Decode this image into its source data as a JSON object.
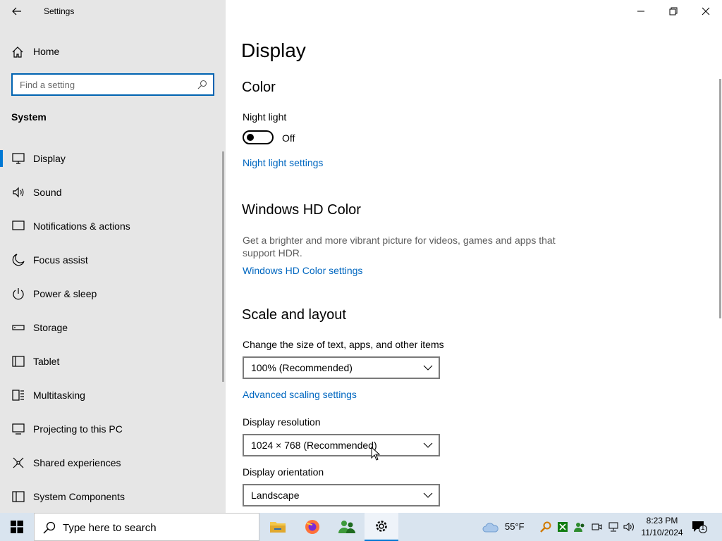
{
  "window": {
    "title": "Settings"
  },
  "sidebar": {
    "home_label": "Home",
    "search_placeholder": "Find a setting",
    "section_label": "System",
    "items": [
      {
        "label": "Display",
        "icon": "monitor-icon",
        "active": true
      },
      {
        "label": "Sound",
        "icon": "speaker-icon"
      },
      {
        "label": "Notifications & actions",
        "icon": "message-icon"
      },
      {
        "label": "Focus assist",
        "icon": "moon-icon"
      },
      {
        "label": "Power & sleep",
        "icon": "power-icon"
      },
      {
        "label": "Storage",
        "icon": "storage-icon"
      },
      {
        "label": "Tablet",
        "icon": "tablet-icon"
      },
      {
        "label": "Multitasking",
        "icon": "multitasking-icon"
      },
      {
        "label": "Projecting to this PC",
        "icon": "projecting-icon"
      },
      {
        "label": "Shared experiences",
        "icon": "shared-icon"
      },
      {
        "label": "System Components",
        "icon": "components-icon"
      }
    ]
  },
  "main": {
    "page_title": "Display",
    "color": {
      "heading": "Color",
      "night_light_label": "Night light",
      "night_light_state": "Off",
      "night_light_link": "Night light settings"
    },
    "hd_color": {
      "heading": "Windows HD Color",
      "description": "Get a brighter and more vibrant picture for videos, games and apps that support HDR.",
      "link": "Windows HD Color settings"
    },
    "scale_layout": {
      "heading": "Scale and layout",
      "scale_label": "Change the size of text, apps, and other items",
      "scale_value": "100% (Recommended)",
      "advanced_link": "Advanced scaling settings",
      "resolution_label": "Display resolution",
      "resolution_value": "1024 × 768 (Recommended)",
      "orientation_label": "Display orientation",
      "orientation_value": "Landscape"
    }
  },
  "taskbar": {
    "search_placeholder": "Type here to search",
    "weather": "55°F",
    "time": "8:23 PM",
    "date": "11/10/2024",
    "notification_count": "1"
  },
  "colors": {
    "accent": "#0078d4",
    "link": "#0067c0",
    "sidebar_bg": "#e6e6e6",
    "taskbar_bg": "#d9e4ef"
  }
}
